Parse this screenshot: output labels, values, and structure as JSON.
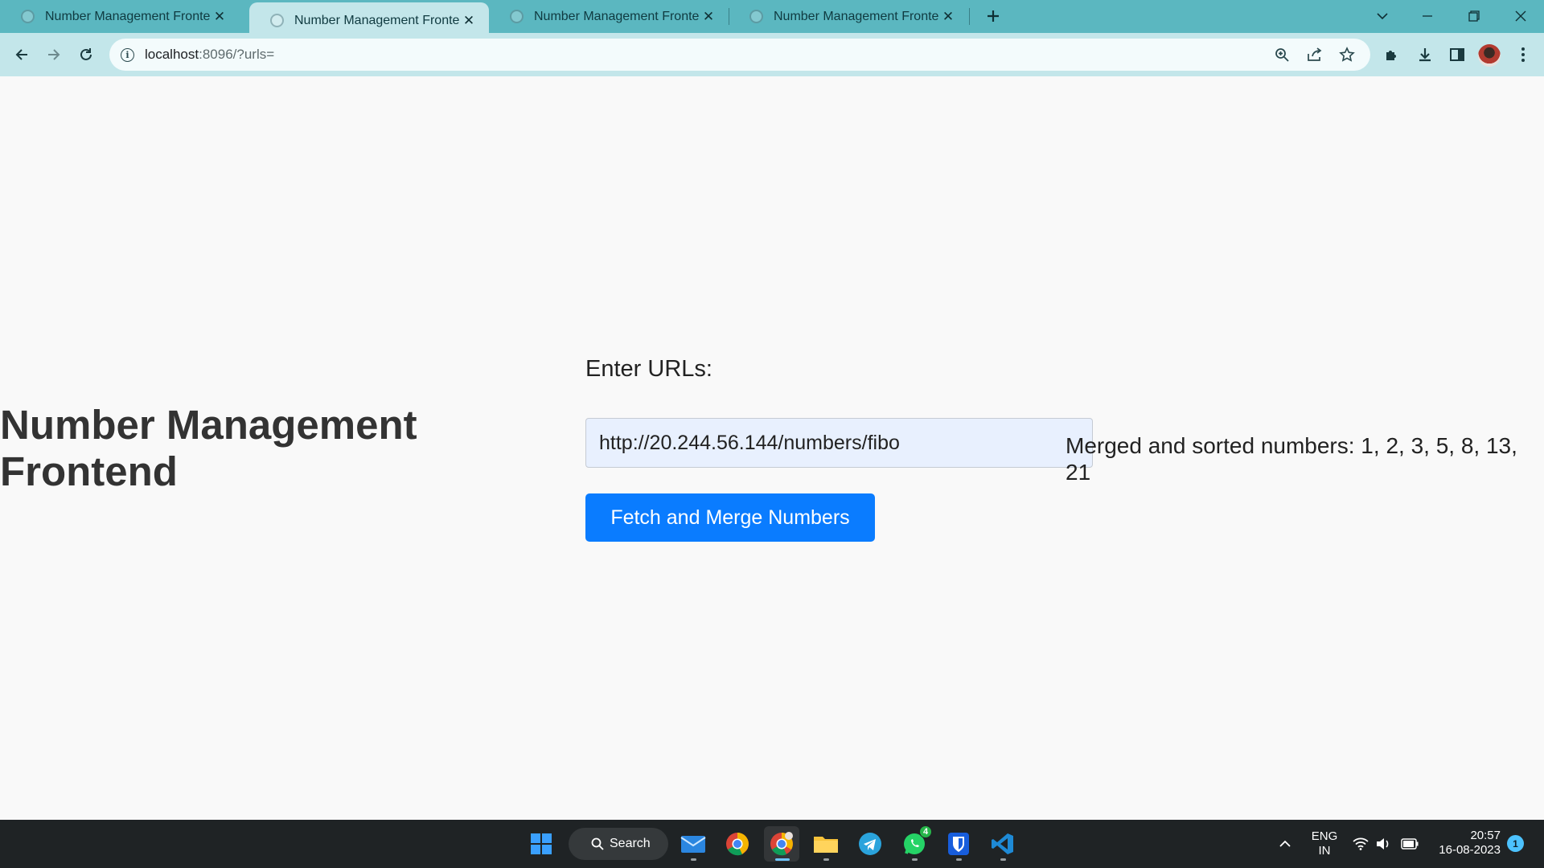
{
  "browser": {
    "tabs": [
      {
        "title": "Number Management Frontend",
        "active": false
      },
      {
        "title": "Number Management Frontend",
        "active": true
      },
      {
        "title": "Number Management Frontend",
        "active": false
      },
      {
        "title": "Number Management Frontend",
        "active": false
      }
    ],
    "new_tab_icon": "plus-icon",
    "url_host": "localhost",
    "url_rest": ":8096/?urls=",
    "colors": {
      "tabstrip": "#5bb7c0",
      "toolbar": "#c3e6ea"
    }
  },
  "page": {
    "title": "Number Management Frontend",
    "input_label": "Enter URLs:",
    "input_value": "http://20.244.56.144/numbers/fibo",
    "button_label": "Fetch and Merge Numbers",
    "result_text": "Merged and sorted numbers: 1, 2, 3, 5, 8, 13, 21",
    "colors": {
      "button": "#0a7cff",
      "input_bg": "#e8f0fe",
      "title": "#333333"
    }
  },
  "taskbar": {
    "search_label": "Search",
    "apps": [
      "windows-start-icon",
      "mail-icon",
      "chrome-icon",
      "chrome-profile-icon",
      "file-explorer-icon",
      "telegram-icon",
      "whatsapp-icon",
      "bitwarden-icon",
      "vscode-icon"
    ],
    "whatsapp_badge": "4",
    "language_line1": "ENG",
    "language_line2": "IN",
    "time": "20:57",
    "date": "16-08-2023",
    "notifications": "1"
  }
}
